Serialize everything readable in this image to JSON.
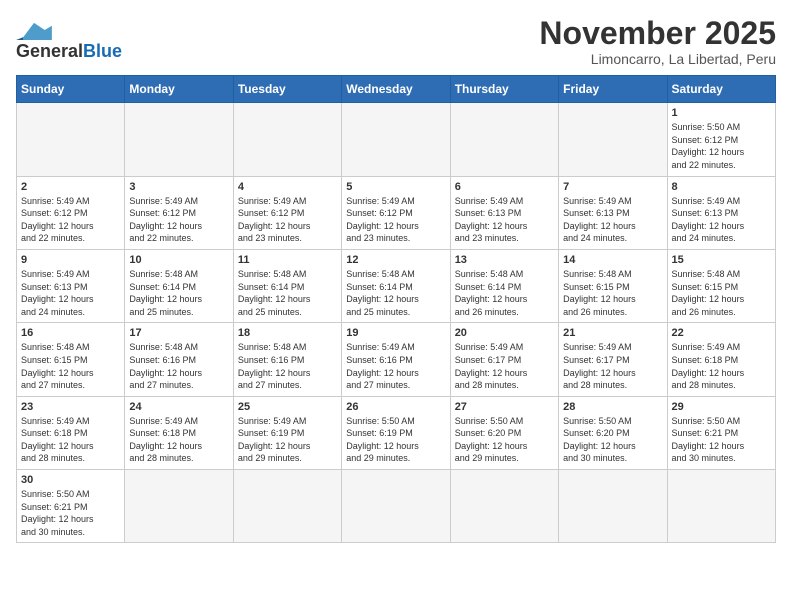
{
  "header": {
    "logo_general": "General",
    "logo_blue": "Blue",
    "month_title": "November 2025",
    "location": "Limoncarro, La Libertad, Peru"
  },
  "weekdays": [
    "Sunday",
    "Monday",
    "Tuesday",
    "Wednesday",
    "Thursday",
    "Friday",
    "Saturday"
  ],
  "days": [
    {
      "date": "",
      "info": ""
    },
    {
      "date": "",
      "info": ""
    },
    {
      "date": "",
      "info": ""
    },
    {
      "date": "",
      "info": ""
    },
    {
      "date": "",
      "info": ""
    },
    {
      "date": "",
      "info": ""
    },
    {
      "date": "1",
      "info": "Sunrise: 5:50 AM\nSunset: 6:12 PM\nDaylight: 12 hours\nand 22 minutes."
    },
    {
      "date": "2",
      "info": "Sunrise: 5:49 AM\nSunset: 6:12 PM\nDaylight: 12 hours\nand 22 minutes."
    },
    {
      "date": "3",
      "info": "Sunrise: 5:49 AM\nSunset: 6:12 PM\nDaylight: 12 hours\nand 22 minutes."
    },
    {
      "date": "4",
      "info": "Sunrise: 5:49 AM\nSunset: 6:12 PM\nDaylight: 12 hours\nand 23 minutes."
    },
    {
      "date": "5",
      "info": "Sunrise: 5:49 AM\nSunset: 6:12 PM\nDaylight: 12 hours\nand 23 minutes."
    },
    {
      "date": "6",
      "info": "Sunrise: 5:49 AM\nSunset: 6:13 PM\nDaylight: 12 hours\nand 23 minutes."
    },
    {
      "date": "7",
      "info": "Sunrise: 5:49 AM\nSunset: 6:13 PM\nDaylight: 12 hours\nand 24 minutes."
    },
    {
      "date": "8",
      "info": "Sunrise: 5:49 AM\nSunset: 6:13 PM\nDaylight: 12 hours\nand 24 minutes."
    },
    {
      "date": "9",
      "info": "Sunrise: 5:49 AM\nSunset: 6:13 PM\nDaylight: 12 hours\nand 24 minutes."
    },
    {
      "date": "10",
      "info": "Sunrise: 5:48 AM\nSunset: 6:14 PM\nDaylight: 12 hours\nand 25 minutes."
    },
    {
      "date": "11",
      "info": "Sunrise: 5:48 AM\nSunset: 6:14 PM\nDaylight: 12 hours\nand 25 minutes."
    },
    {
      "date": "12",
      "info": "Sunrise: 5:48 AM\nSunset: 6:14 PM\nDaylight: 12 hours\nand 25 minutes."
    },
    {
      "date": "13",
      "info": "Sunrise: 5:48 AM\nSunset: 6:14 PM\nDaylight: 12 hours\nand 26 minutes."
    },
    {
      "date": "14",
      "info": "Sunrise: 5:48 AM\nSunset: 6:15 PM\nDaylight: 12 hours\nand 26 minutes."
    },
    {
      "date": "15",
      "info": "Sunrise: 5:48 AM\nSunset: 6:15 PM\nDaylight: 12 hours\nand 26 minutes."
    },
    {
      "date": "16",
      "info": "Sunrise: 5:48 AM\nSunset: 6:15 PM\nDaylight: 12 hours\nand 27 minutes."
    },
    {
      "date": "17",
      "info": "Sunrise: 5:48 AM\nSunset: 6:16 PM\nDaylight: 12 hours\nand 27 minutes."
    },
    {
      "date": "18",
      "info": "Sunrise: 5:48 AM\nSunset: 6:16 PM\nDaylight: 12 hours\nand 27 minutes."
    },
    {
      "date": "19",
      "info": "Sunrise: 5:49 AM\nSunset: 6:16 PM\nDaylight: 12 hours\nand 27 minutes."
    },
    {
      "date": "20",
      "info": "Sunrise: 5:49 AM\nSunset: 6:17 PM\nDaylight: 12 hours\nand 28 minutes."
    },
    {
      "date": "21",
      "info": "Sunrise: 5:49 AM\nSunset: 6:17 PM\nDaylight: 12 hours\nand 28 minutes."
    },
    {
      "date": "22",
      "info": "Sunrise: 5:49 AM\nSunset: 6:18 PM\nDaylight: 12 hours\nand 28 minutes."
    },
    {
      "date": "23",
      "info": "Sunrise: 5:49 AM\nSunset: 6:18 PM\nDaylight: 12 hours\nand 28 minutes."
    },
    {
      "date": "24",
      "info": "Sunrise: 5:49 AM\nSunset: 6:18 PM\nDaylight: 12 hours\nand 28 minutes."
    },
    {
      "date": "25",
      "info": "Sunrise: 5:49 AM\nSunset: 6:19 PM\nDaylight: 12 hours\nand 29 minutes."
    },
    {
      "date": "26",
      "info": "Sunrise: 5:50 AM\nSunset: 6:19 PM\nDaylight: 12 hours\nand 29 minutes."
    },
    {
      "date": "27",
      "info": "Sunrise: 5:50 AM\nSunset: 6:20 PM\nDaylight: 12 hours\nand 29 minutes."
    },
    {
      "date": "28",
      "info": "Sunrise: 5:50 AM\nSunset: 6:20 PM\nDaylight: 12 hours\nand 30 minutes."
    },
    {
      "date": "29",
      "info": "Sunrise: 5:50 AM\nSunset: 6:21 PM\nDaylight: 12 hours\nand 30 minutes."
    },
    {
      "date": "30",
      "info": "Sunrise: 5:50 AM\nSunset: 6:21 PM\nDaylight: 12 hours\nand 30 minutes."
    },
    {
      "date": "",
      "info": ""
    },
    {
      "date": "",
      "info": ""
    },
    {
      "date": "",
      "info": ""
    },
    {
      "date": "",
      "info": ""
    },
    {
      "date": "",
      "info": ""
    },
    {
      "date": "",
      "info": ""
    }
  ]
}
